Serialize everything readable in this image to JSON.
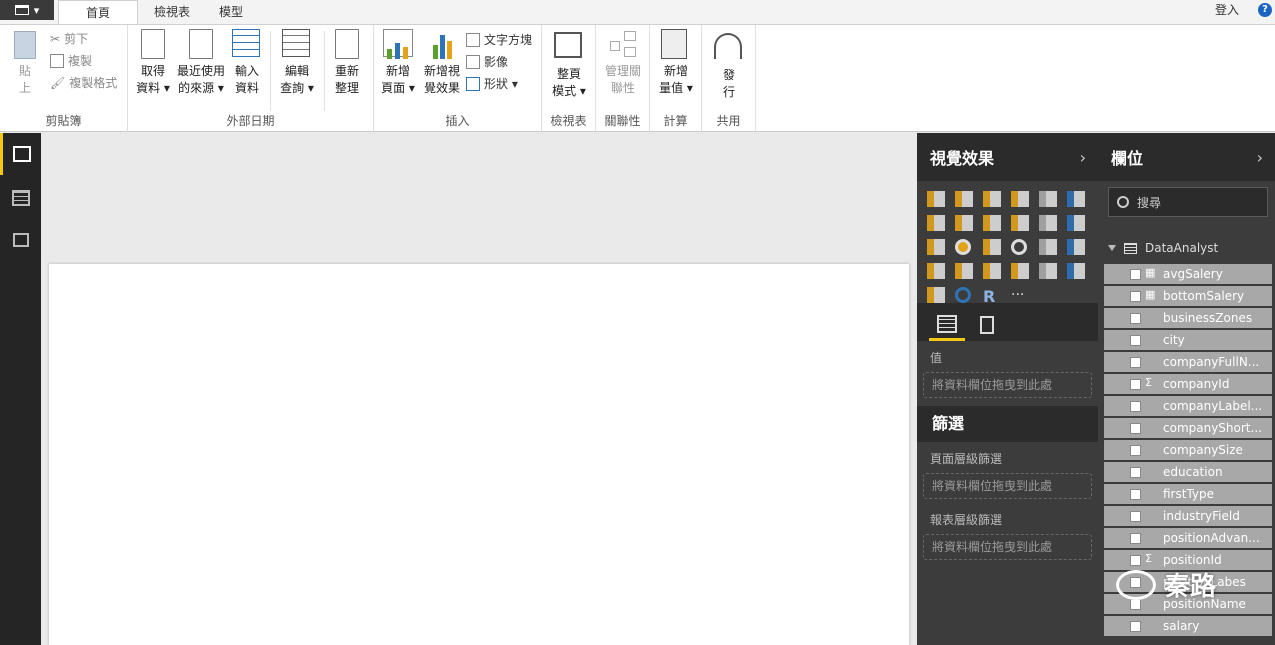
{
  "topbar": {
    "tabs": [
      "首頁",
      "檢視表",
      "模型"
    ],
    "signin": "登入",
    "help": "?"
  },
  "ribbon": {
    "groups": [
      {
        "label": "剪貼簿",
        "big": {
          "label1": "貼",
          "label2": "上"
        },
        "small": [
          "剪下",
          "複製",
          "複製格式"
        ]
      },
      {
        "label": "外部日期",
        "buttons": [
          {
            "l1": "取得",
            "l2": "資料 ▾"
          },
          {
            "l1": "最近使用",
            "l2": "的來源 ▾"
          },
          {
            "l1": "輸入",
            "l2": "資料"
          },
          {
            "l1": "編輯",
            "l2": "查詢 ▾"
          },
          {
            "l1": "重新",
            "l2": "整理"
          }
        ]
      },
      {
        "label": "插入",
        "buttons": [
          {
            "l1": "新增",
            "l2": "頁面 ▾"
          },
          {
            "l1": "新增視",
            "l2": "覺效果"
          }
        ],
        "small": [
          "文字方塊",
          "影像",
          "形狀 ▾"
        ]
      },
      {
        "label": "檢視表",
        "buttons": [
          {
            "l1": "整頁",
            "l2": "模式 ▾"
          }
        ]
      },
      {
        "label": "關聯性",
        "buttons": [
          {
            "l1": "管理關",
            "l2": "聯性"
          }
        ]
      },
      {
        "label": "計算",
        "buttons": [
          {
            "l1": "新增",
            "l2": "量值 ▾"
          }
        ]
      },
      {
        "label": "共用",
        "buttons": [
          {
            "l1": "發",
            "l2": "行"
          }
        ]
      }
    ]
  },
  "viz": {
    "title": "視覺效果",
    "values_label": "值",
    "drop_hint": "將資料欄位拖曳到此處",
    "filters_title": "篩選",
    "page_filters": "頁面層級篩選",
    "report_filters": "報表層級篩選"
  },
  "fields_pane": {
    "title": "欄位",
    "search_placeholder": "搜尋",
    "table_name": "DataAnalyst",
    "fields": [
      {
        "name": "avgSalery",
        "type": "calc"
      },
      {
        "name": "bottomSalery",
        "type": "calc"
      },
      {
        "name": "businessZones",
        "type": ""
      },
      {
        "name": "city",
        "type": ""
      },
      {
        "name": "companyFullN...",
        "type": ""
      },
      {
        "name": "companyId",
        "type": "sum"
      },
      {
        "name": "companyLabel...",
        "type": ""
      },
      {
        "name": "companyShort...",
        "type": ""
      },
      {
        "name": "companySize",
        "type": ""
      },
      {
        "name": "education",
        "type": ""
      },
      {
        "name": "firstType",
        "type": ""
      },
      {
        "name": "industryField",
        "type": ""
      },
      {
        "name": "positionAdvan...",
        "type": ""
      },
      {
        "name": "positionId",
        "type": "sum"
      },
      {
        "name": "positionLabes",
        "type": ""
      },
      {
        "name": "positionName",
        "type": ""
      },
      {
        "name": "salary",
        "type": ""
      }
    ]
  },
  "watermark": {
    "text": "秦路"
  },
  "colors": {
    "accent": "#f2c811",
    "pane_bg": "#3c3c3c",
    "pane_head": "#2b2b2b",
    "field_bg": "#a8a8a8"
  }
}
